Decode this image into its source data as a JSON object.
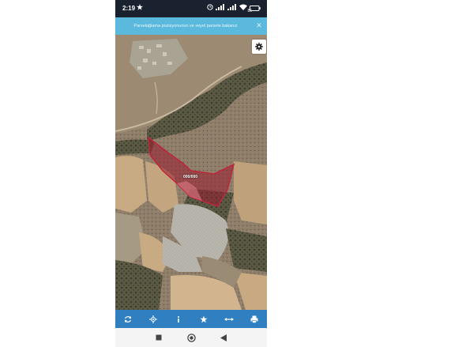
{
  "status_bar": {
    "time": "2:19",
    "battery": "85"
  },
  "banner": {
    "text": "Parselağlama pozisyonunun ve veyel parsele bakanız",
    "close_icon": "close-icon"
  },
  "map": {
    "parcel_label": "000/000",
    "settings_icon": "gear-icon",
    "parcel_color": "#9b1c2e"
  },
  "toolbar": {
    "items": [
      "refresh-icon",
      "locate-icon",
      "info-icon",
      "star-icon",
      "measure-icon",
      "print-icon"
    ],
    "color": "#2f7fc1"
  },
  "navbar": {
    "items": [
      "recents-icon",
      "home-icon",
      "back-icon"
    ]
  }
}
